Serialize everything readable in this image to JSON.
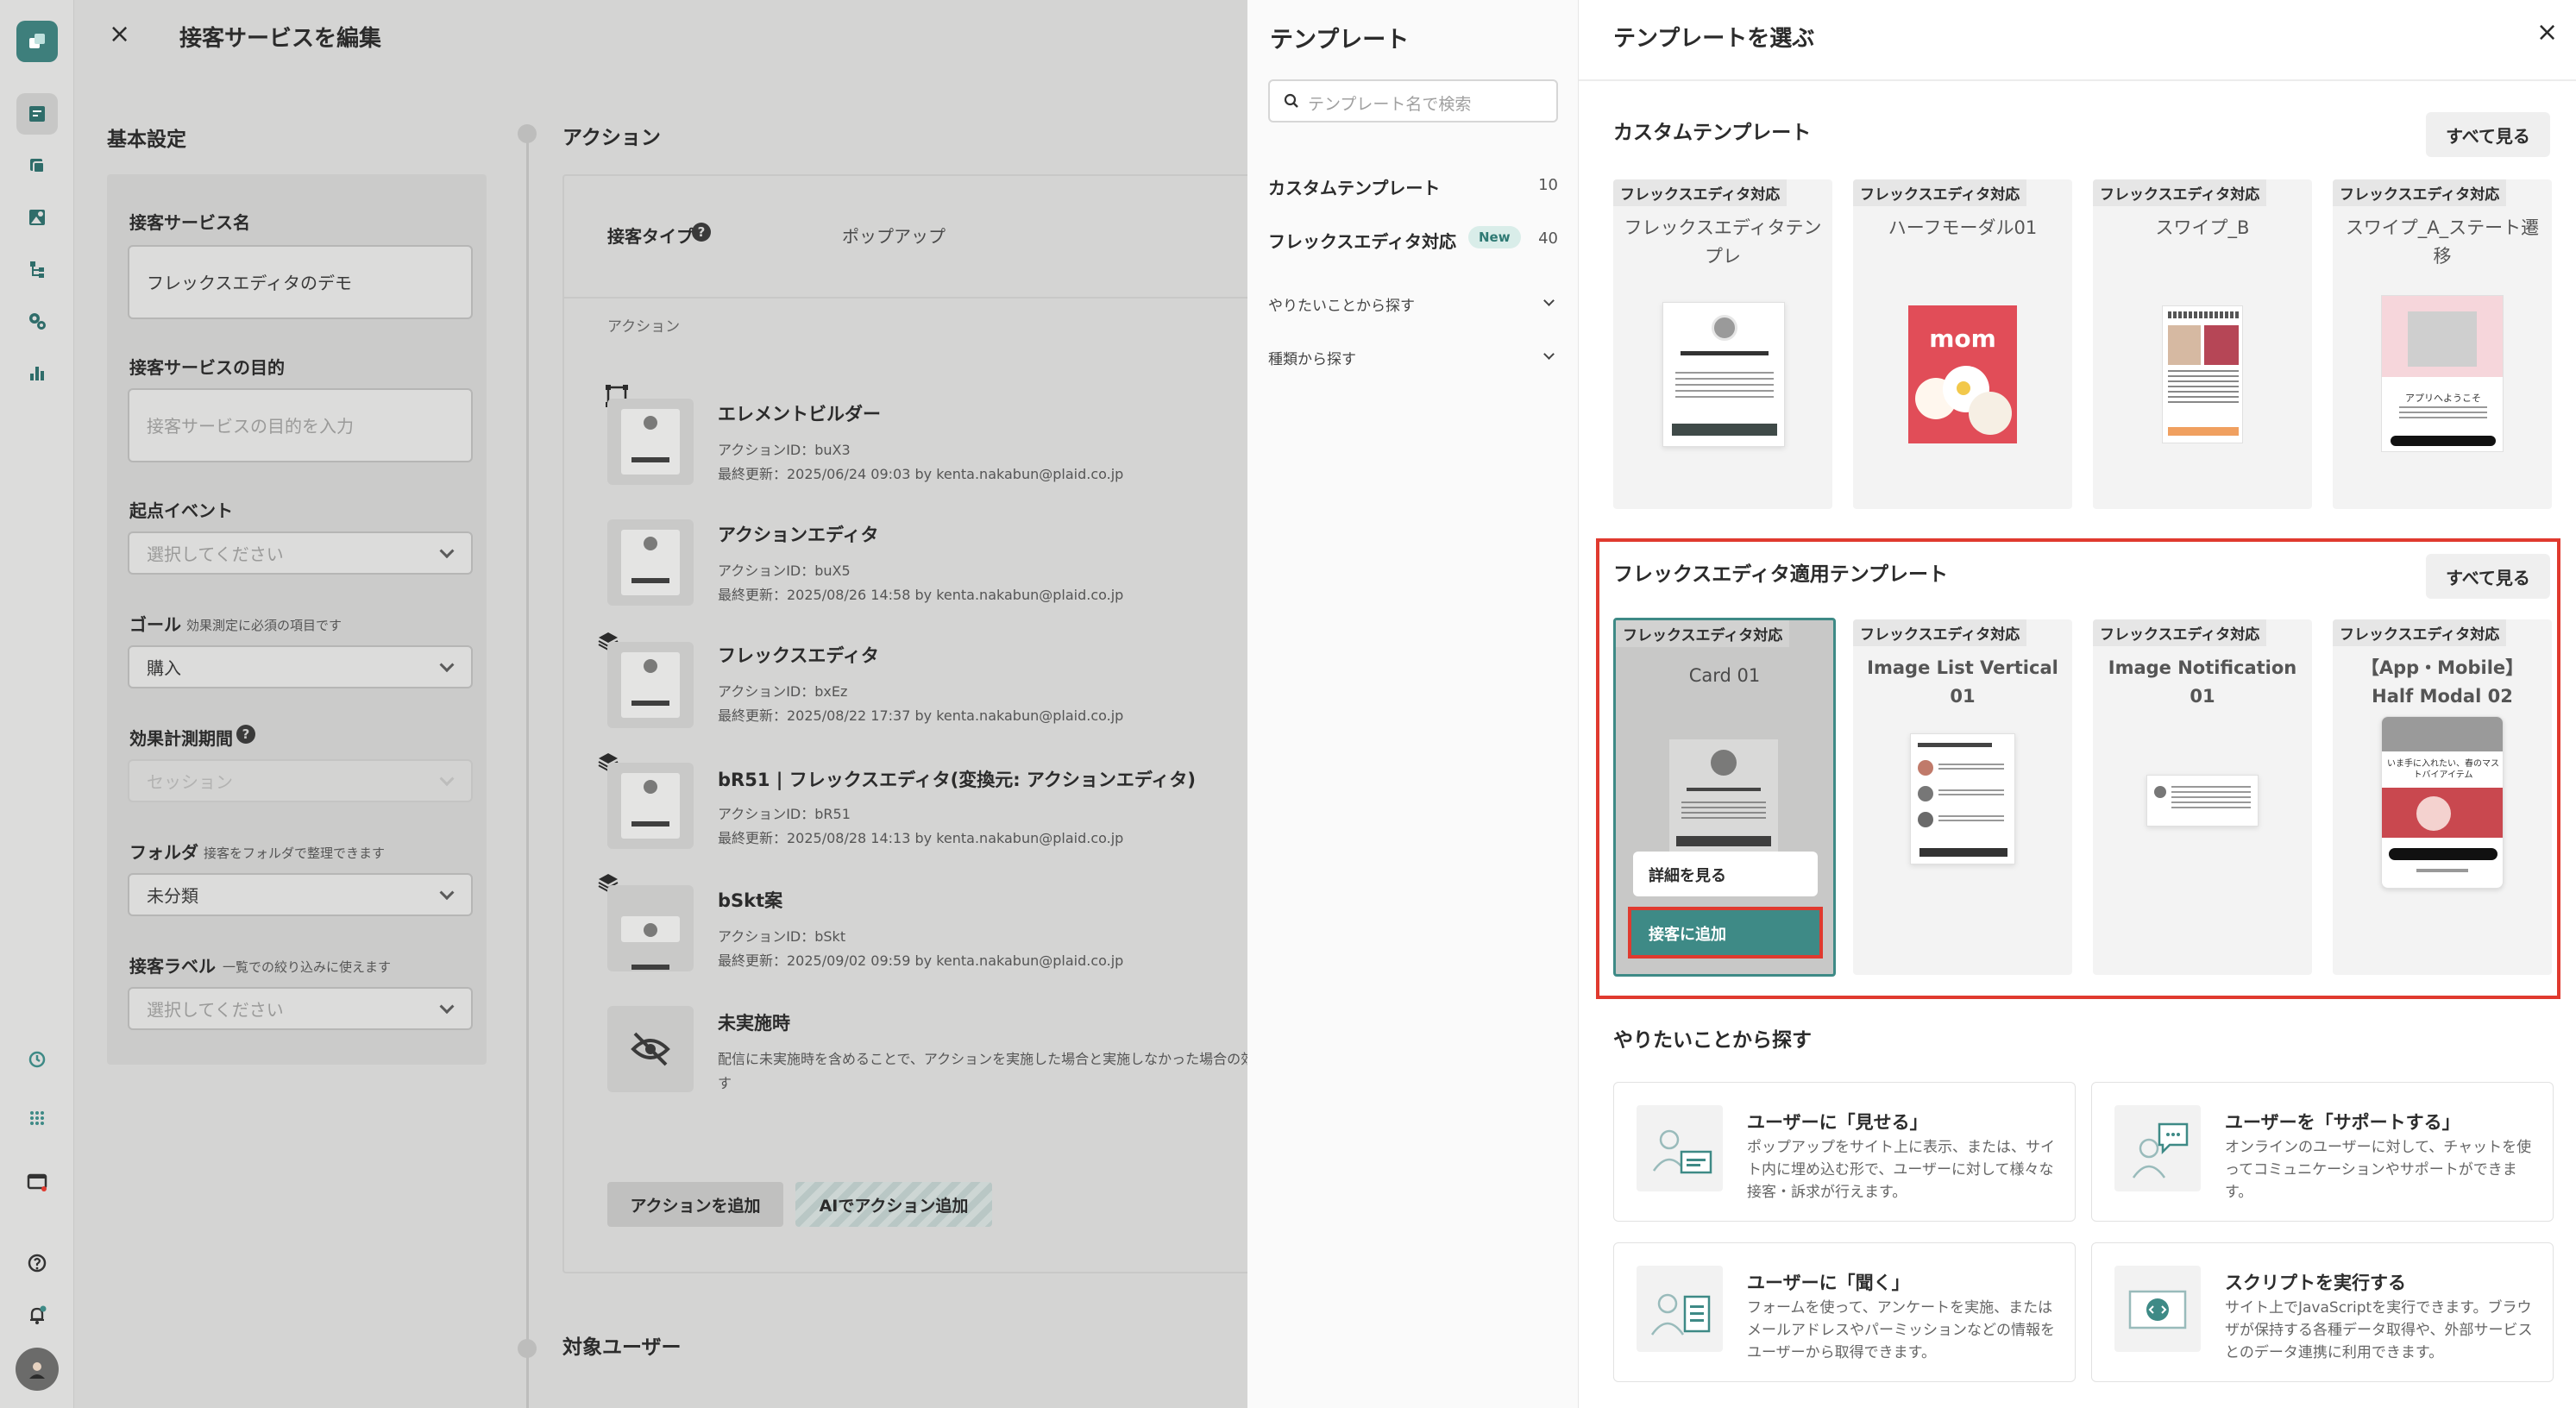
{
  "editor": {
    "close_glyph": "×",
    "title": "接客サービスを編集",
    "basic_settings_heading": "基本設定",
    "fields": {
      "service_name_label": "接客サービス名",
      "service_name_value": "フレックスエディタのデモ",
      "purpose_label": "接客サービスの目的",
      "purpose_placeholder": "接客サービスの目的を入力",
      "start_event_label": "起点イベント",
      "start_event_placeholder": "選択してください",
      "goal_label": "ゴール",
      "goal_hint": "効果測定に必須の項目です",
      "goal_value": "購入",
      "period_label": "効果計測期間",
      "period_value": "セッション",
      "folder_label": "フォルダ",
      "folder_hint": "接客をフォルダで整理できます",
      "folder_value": "未分類",
      "label_label": "接客ラベル",
      "label_hint": "一覧での絞り込みに使えます",
      "label_placeholder": "選択してください"
    },
    "action_heading": "アクション",
    "service_type_label": "接客タイプ",
    "service_type_value": "ポップアップ",
    "action_col_label": "アクション",
    "actions": [
      {
        "name": "エレメントビルダー",
        "id": "アクションID：buX3",
        "updated": "最終更新：2025/06/24 09:03 by kenta.nakabun@plaid.co.jp"
      },
      {
        "name": "アクションエディタ",
        "id": "アクションID：buX5",
        "updated": "最終更新：2025/08/26 14:58 by kenta.nakabun@plaid.co.jp"
      },
      {
        "name": "フレックスエディタ",
        "id": "アクションID：bxEz",
        "updated": "最終更新：2025/08/22 17:37 by kenta.nakabun@plaid.co.jp"
      },
      {
        "name": "bR51 | フレックスエディタ(変換元: アクションエディタ)",
        "id": "アクションID：bR51",
        "updated": "最終更新：2025/08/28 14:13 by kenta.nakabun@plaid.co.jp"
      },
      {
        "name": "bSkt案",
        "id": "アクションID：bSkt",
        "updated": "最終更新：2025/09/02 09:59 by kenta.nakabun@plaid.co.jp"
      }
    ],
    "no_action_title": "未実施時",
    "no_action_desc_1": "配信に未実施時を含めることで、アクションを実施した場合と実施しなかった場合の効",
    "no_action_desc_2": "す",
    "add_action_button": "アクションを追加",
    "ai_add_action_button": "AIでアクション追加",
    "target_users_heading": "対象ユーザー"
  },
  "template_sidebar": {
    "title": "テンプレート",
    "search_placeholder": "テンプレート名で検索",
    "categories": [
      {
        "label": "カスタムテンプレート",
        "count": "10"
      },
      {
        "label": "フレックスエディタ対応",
        "badge": "New",
        "count": "40"
      }
    ],
    "filters": [
      "やりたいことから探す",
      "種類から探す"
    ]
  },
  "template_panel": {
    "title": "テンプレートを選ぶ",
    "close_glyph": "×",
    "custom_section_title": "カスタムテンプレート",
    "see_all_label": "すべて見る",
    "badge_label": "フレックスエディタ対応",
    "custom_templates": [
      {
        "title": "フレックスエディタテンプレ"
      },
      {
        "title": "ハーフモーダル01",
        "preview_text": "mom"
      },
      {
        "title": "スワイプ_B"
      },
      {
        "title": "スワイプ_A_ステート遷移",
        "preview_text": "アプリへようこそ"
      }
    ],
    "flex_section_title": "フレックスエディタ適用テンプレート",
    "flex_templates": [
      {
        "title": "Card 01"
      },
      {
        "title": "Image List Vertical 01"
      },
      {
        "title": "Image Notification 01"
      },
      {
        "title": "【App・Mobile】Half Modal 02",
        "preview_text": "いま手に入れたい、春のマストバイアイテム"
      }
    ],
    "hover_detail_button": "詳細を見る",
    "hover_add_button": "接客に追加",
    "purpose_section_title": "やりたいことから探す",
    "purposes": [
      {
        "title": "ユーザーに「見せる」",
        "desc": "ポップアップをサイト上に表示、または、サイト内に埋め込む形で、ユーザーに対して様々な接客・訴求が行えます。"
      },
      {
        "title": "ユーザーを「サポートする」",
        "desc": "オンラインのユーザーに対して、チャットを使ってコミュニケーションやサポートができます。"
      },
      {
        "title": "ユーザーに「聞く」",
        "desc": "フォームを使って、アンケートを実施、またはメールアドレスやパーミッションなどの情報をユーザーから取得できます。"
      },
      {
        "title": "スクリプトを実行する",
        "desc": "サイト上でJavaScriptを実行できます。ブラウザが保持する各種データ取得や、外部サービスとのデータ連携に利用できます。"
      }
    ]
  },
  "colors": {
    "accent": "#3e8a86",
    "highlight_red": "#e03a2f",
    "overlay": "#d4d4d3"
  }
}
